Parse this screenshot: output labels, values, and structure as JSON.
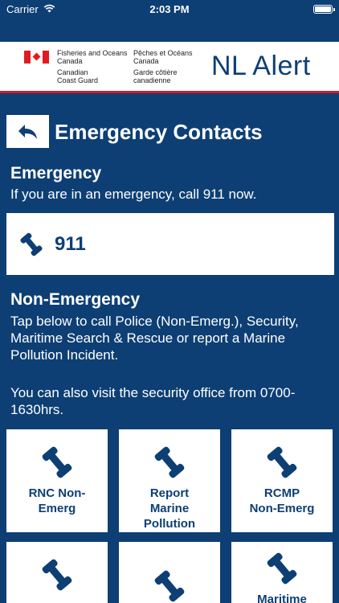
{
  "status_bar": {
    "carrier": "Carrier",
    "time": "2:03 PM"
  },
  "banner": {
    "fip_en_line1": "Fisheries and Oceans",
    "fip_en_line2": "Canada",
    "fip_fr_line1": "Pêches et Océans",
    "fip_fr_line2": "Canada",
    "ccg_en_line1": "Canadian",
    "ccg_en_line2": "Coast Guard",
    "ccg_fr_line1": "Garde côtière",
    "ccg_fr_line2": "canadienne",
    "app_title": "NL Alert"
  },
  "page": {
    "title": "Emergency Contacts",
    "back_icon": "back-arrow-icon"
  },
  "emergency": {
    "heading": "Emergency",
    "description": "If you are in an emergency, call 911 now.",
    "number": "911"
  },
  "non_emergency": {
    "heading": "Non-Emergency",
    "description": "Tap below to call Police (Non-Emerg.), Security, Maritime Search & Rescue or report a Marine Pollution Incident.",
    "note": "You can also visit the security office from 0700-1630hrs."
  },
  "tiles": [
    {
      "label_line1": "RNC Non-",
      "label_line2": "Emerg",
      "label_line3": ""
    },
    {
      "label_line1": "Report",
      "label_line2": "Marine",
      "label_line3": "Pollution"
    },
    {
      "label_line1": "RCMP",
      "label_line2": "Non-Emerg",
      "label_line3": ""
    },
    {
      "label_line1": "",
      "label_line2": "",
      "label_line3": ""
    },
    {
      "label_line1": "",
      "label_line2": "",
      "label_line3": ""
    },
    {
      "label_line1": "Maritime",
      "label_line2": "",
      "label_line3": ""
    }
  ],
  "colors": {
    "background": "#0d3f74",
    "card": "#ffffff",
    "accent_red": "#c8202b"
  }
}
